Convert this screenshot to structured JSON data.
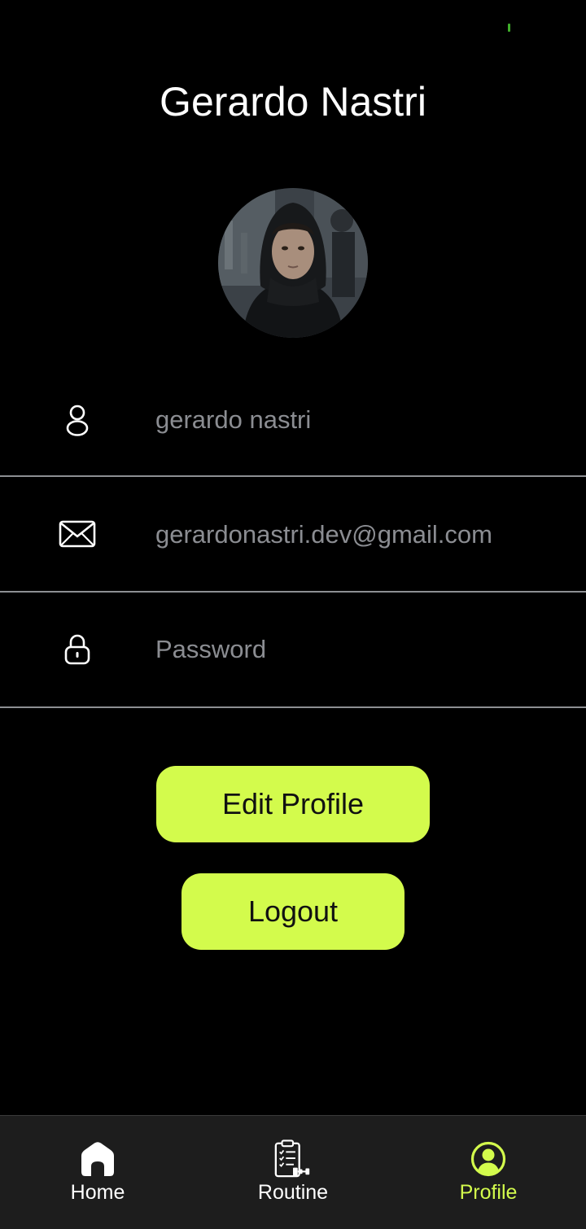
{
  "header": {
    "title": "Gerardo Nastri"
  },
  "profile": {
    "avatar_icon": "profile-photo",
    "fields": [
      {
        "icon": "user-icon",
        "value": "gerardo nastri"
      },
      {
        "icon": "mail-icon",
        "value": "gerardonastri.dev@gmail.com"
      },
      {
        "icon": "lock-icon",
        "placeholder": "Password"
      }
    ]
  },
  "actions": {
    "edit_label": "Edit Profile",
    "logout_label": "Logout"
  },
  "bottom_nav": {
    "items": [
      {
        "label": "Home",
        "icon": "home-icon",
        "active": false
      },
      {
        "label": "Routine",
        "icon": "clipboard-icon",
        "active": false
      },
      {
        "label": "Profile",
        "icon": "profile-icon",
        "active": true
      }
    ]
  },
  "colors": {
    "accent": "#d3fb4c",
    "background": "#000000",
    "nav_background": "#1d1d1d",
    "muted_text": "#8b8d92",
    "divider": "#8d8f93"
  }
}
